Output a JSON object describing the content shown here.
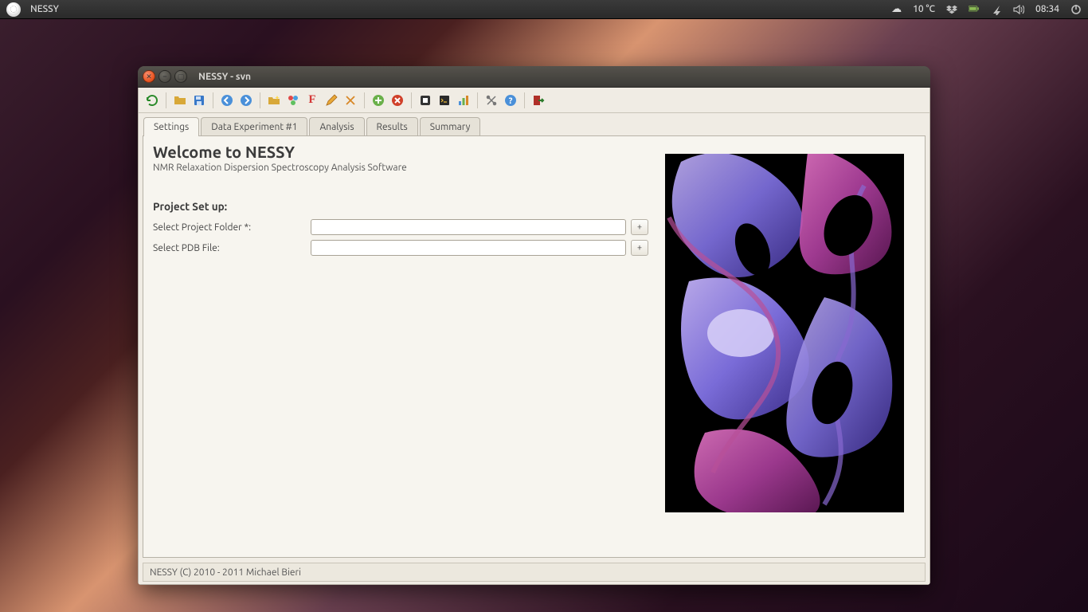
{
  "panel": {
    "app_name": "NESSY",
    "temperature": "10 °C",
    "clock": "08:34"
  },
  "window": {
    "title": "NESSY - svn"
  },
  "tabs": {
    "settings": "Settings",
    "data_exp": "Data Experiment #1",
    "analysis": "Analysis",
    "results": "Results",
    "summary": "Summary"
  },
  "settings": {
    "welcome_heading": "Welcome to NESSY",
    "subtitle": "NMR Relaxation Dispersion Spectroscopy Analysis Software",
    "project_setup_heading": "Project Set up:",
    "project_folder_label": "Select Project Folder *:",
    "pdb_file_label": "Select PDB File:",
    "project_folder_value": "",
    "pdb_file_value": "",
    "plus_button": "+"
  },
  "status": {
    "text": "NESSY (C) 2010 - 2011 Michael Bieri"
  }
}
